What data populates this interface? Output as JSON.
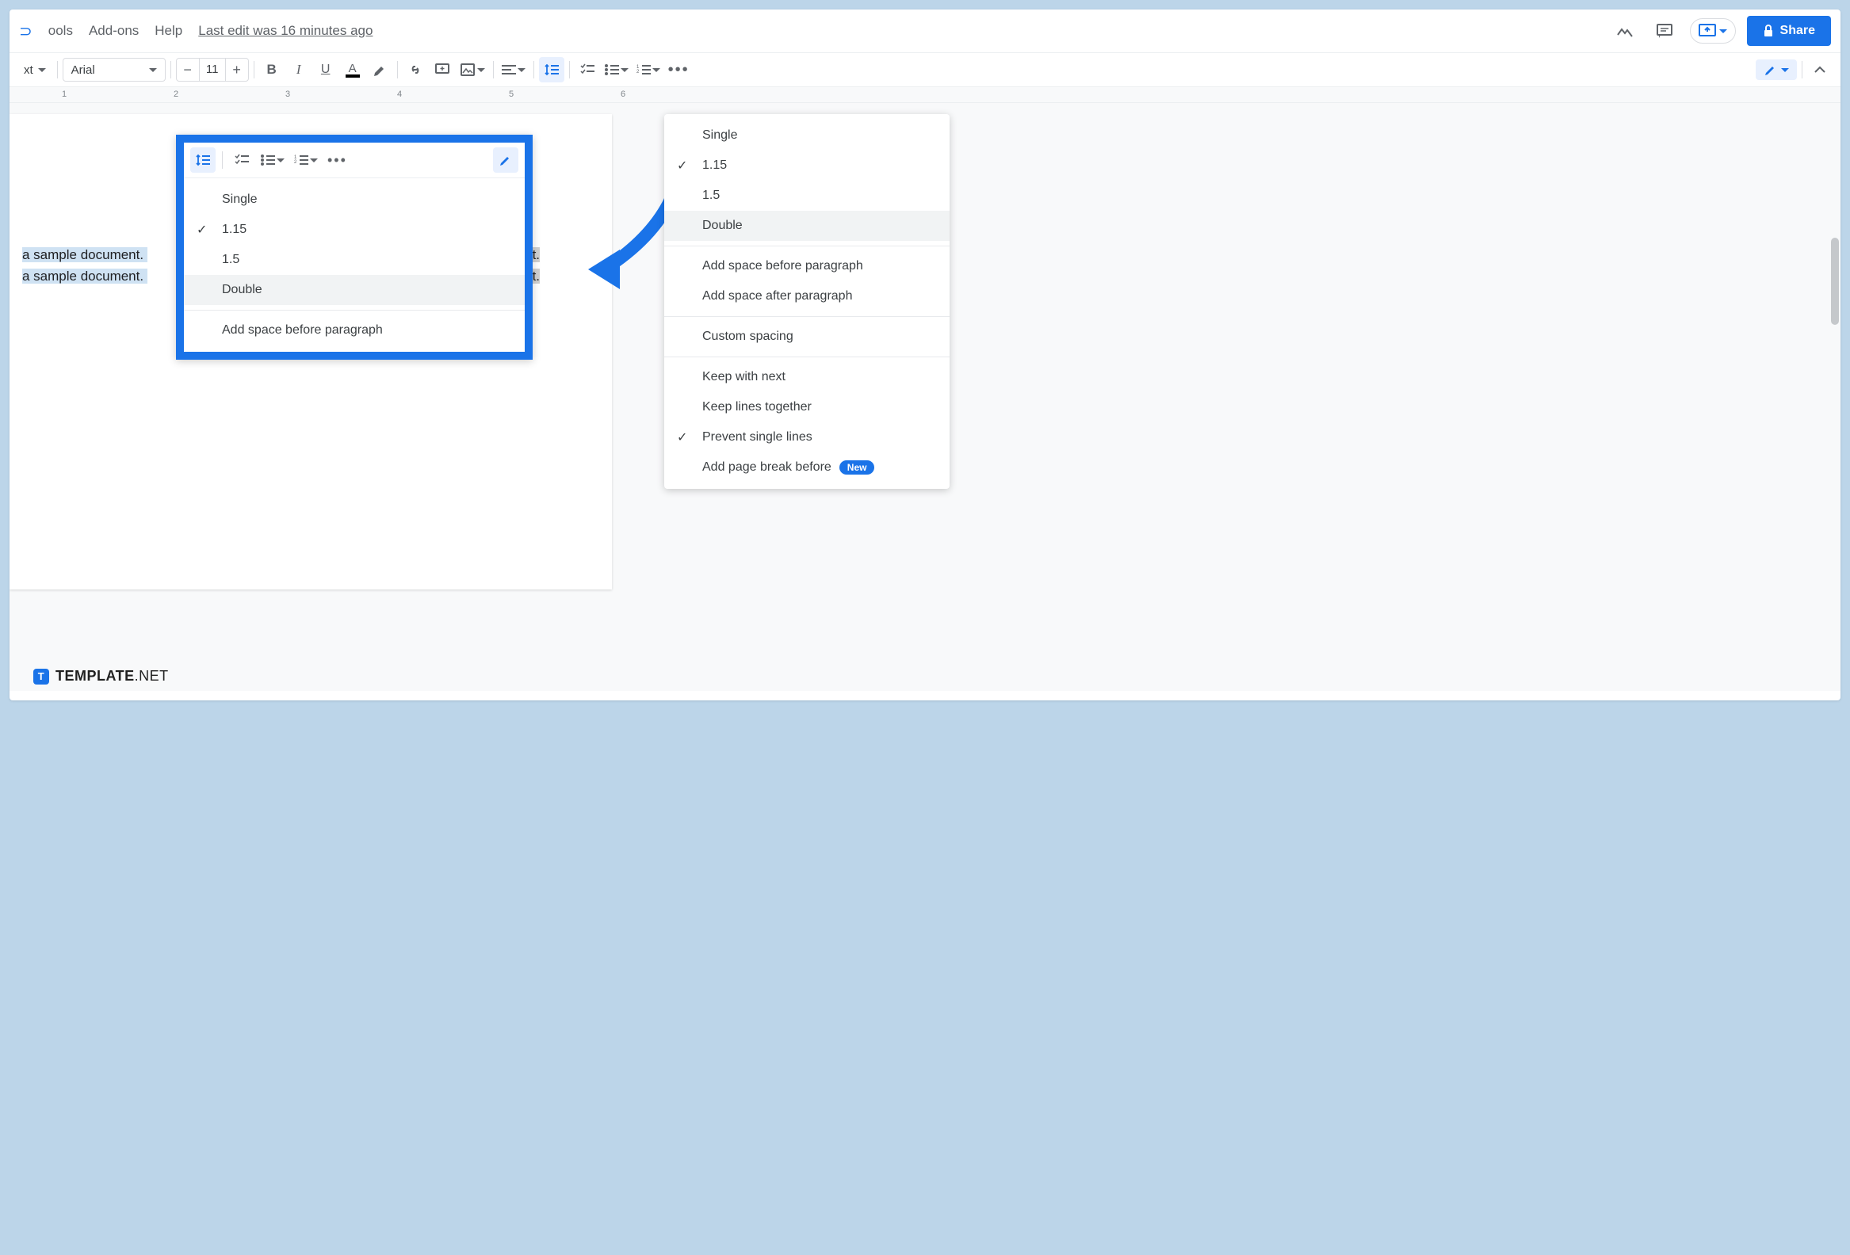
{
  "menubar": {
    "items": [
      "ools",
      "Add-ons",
      "Help"
    ],
    "last_edit": "Last edit was 16 minutes ago",
    "share": "Share"
  },
  "toolbar": {
    "style_label": "xt",
    "font": "Arial",
    "size": "11"
  },
  "ruler": {
    "marks": [
      "1",
      "2",
      "3",
      "4",
      "5",
      "6"
    ]
  },
  "document": {
    "line1_a": " a sample document. ",
    "line1_b": "cument. ",
    "line2_a": " a sample document. ",
    "line2_b": "cument."
  },
  "spacing_menu": {
    "items": [
      {
        "label": "Single",
        "checked": false
      },
      {
        "label": "1.15",
        "checked": true
      },
      {
        "label": "1.5",
        "checked": false
      },
      {
        "label": "Double",
        "checked": false,
        "hover": true
      }
    ],
    "groups": [
      [
        "Add space before paragraph",
        "Add space after paragraph"
      ],
      [
        "Custom spacing"
      ],
      [
        "Keep with next",
        "Keep lines together"
      ]
    ],
    "prevent": {
      "label": "Prevent single lines",
      "checked": true
    },
    "page_break": {
      "label": "Add page break before",
      "badge": "New"
    }
  },
  "callout_menu": {
    "items": [
      {
        "label": "Single",
        "checked": false
      },
      {
        "label": "1.15",
        "checked": true
      },
      {
        "label": "1.5",
        "checked": false
      },
      {
        "label": "Double",
        "checked": false,
        "hover": true
      }
    ],
    "extra": "Add space before paragraph"
  },
  "watermark": {
    "bold": "TEMPLATE",
    "light": ".NET",
    "icon": "T"
  }
}
